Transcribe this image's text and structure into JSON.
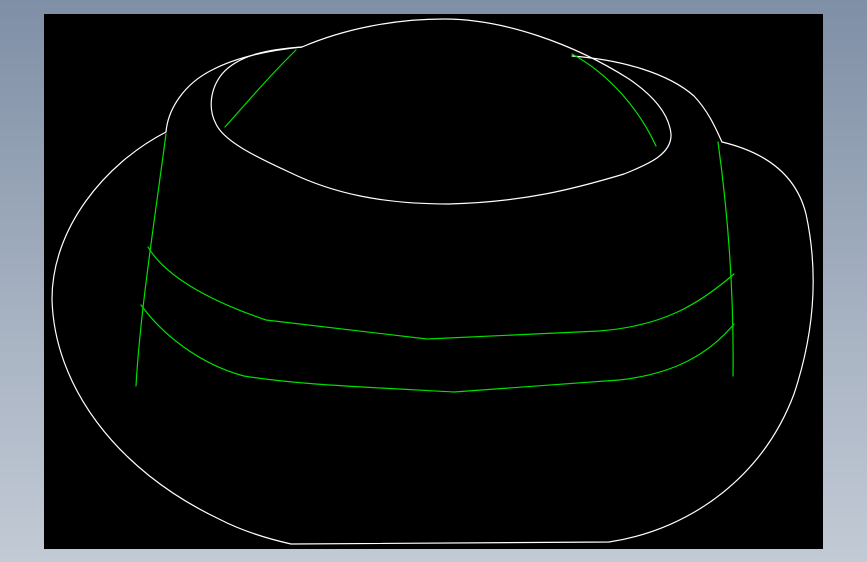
{
  "drawing": {
    "background_color": "#000000",
    "edge_color": "#ffffff",
    "band_color": "#00e000"
  }
}
